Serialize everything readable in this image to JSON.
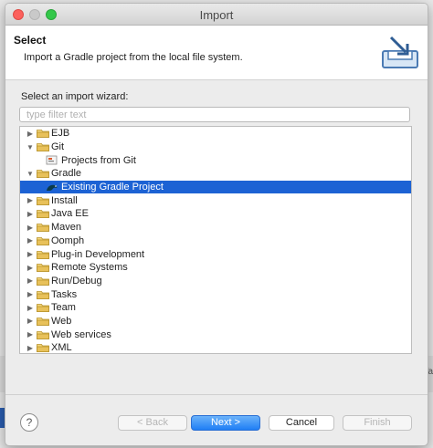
{
  "window": {
    "title": "Import"
  },
  "header": {
    "title": "Select",
    "description": "Import a Gradle project from the local file system."
  },
  "wizard": {
    "label": "Select an import wizard:",
    "filter_placeholder": "type filter text",
    "filter_value": ""
  },
  "tree": [
    {
      "label": "EJB",
      "expanded": false,
      "icon": "folder-icon"
    },
    {
      "label": "Git",
      "expanded": true,
      "icon": "folder-icon"
    },
    {
      "label": "Projects from Git",
      "child": true,
      "icon": "git-projects-icon"
    },
    {
      "label": "Gradle",
      "expanded": true,
      "icon": "folder-icon"
    },
    {
      "label": "Existing Gradle Project",
      "child": true,
      "selected": true,
      "icon": "gradle-icon"
    },
    {
      "label": "Install",
      "expanded": false,
      "icon": "folder-icon"
    },
    {
      "label": "Java EE",
      "expanded": false,
      "icon": "folder-icon"
    },
    {
      "label": "Maven",
      "expanded": false,
      "icon": "folder-icon"
    },
    {
      "label": "Oomph",
      "expanded": false,
      "icon": "folder-icon"
    },
    {
      "label": "Plug-in Development",
      "expanded": false,
      "icon": "folder-icon"
    },
    {
      "label": "Remote Systems",
      "expanded": false,
      "icon": "folder-icon"
    },
    {
      "label": "Run/Debug",
      "expanded": false,
      "icon": "folder-icon"
    },
    {
      "label": "Tasks",
      "expanded": false,
      "icon": "folder-icon"
    },
    {
      "label": "Team",
      "expanded": false,
      "icon": "folder-icon"
    },
    {
      "label": "Web",
      "expanded": false,
      "icon": "folder-icon"
    },
    {
      "label": "Web services",
      "expanded": false,
      "icon": "folder-icon"
    },
    {
      "label": "XML",
      "expanded": false,
      "icon": "folder-icon"
    }
  ],
  "buttons": {
    "help": "?",
    "back": "< Back",
    "next": "Next >",
    "cancel": "Cancel",
    "finish": "Finish"
  },
  "background": {
    "right_text": "Ta"
  },
  "colors": {
    "selection": "#1c62d4",
    "primary_button": "#1f7ef5",
    "folder": "#e8c15a"
  }
}
